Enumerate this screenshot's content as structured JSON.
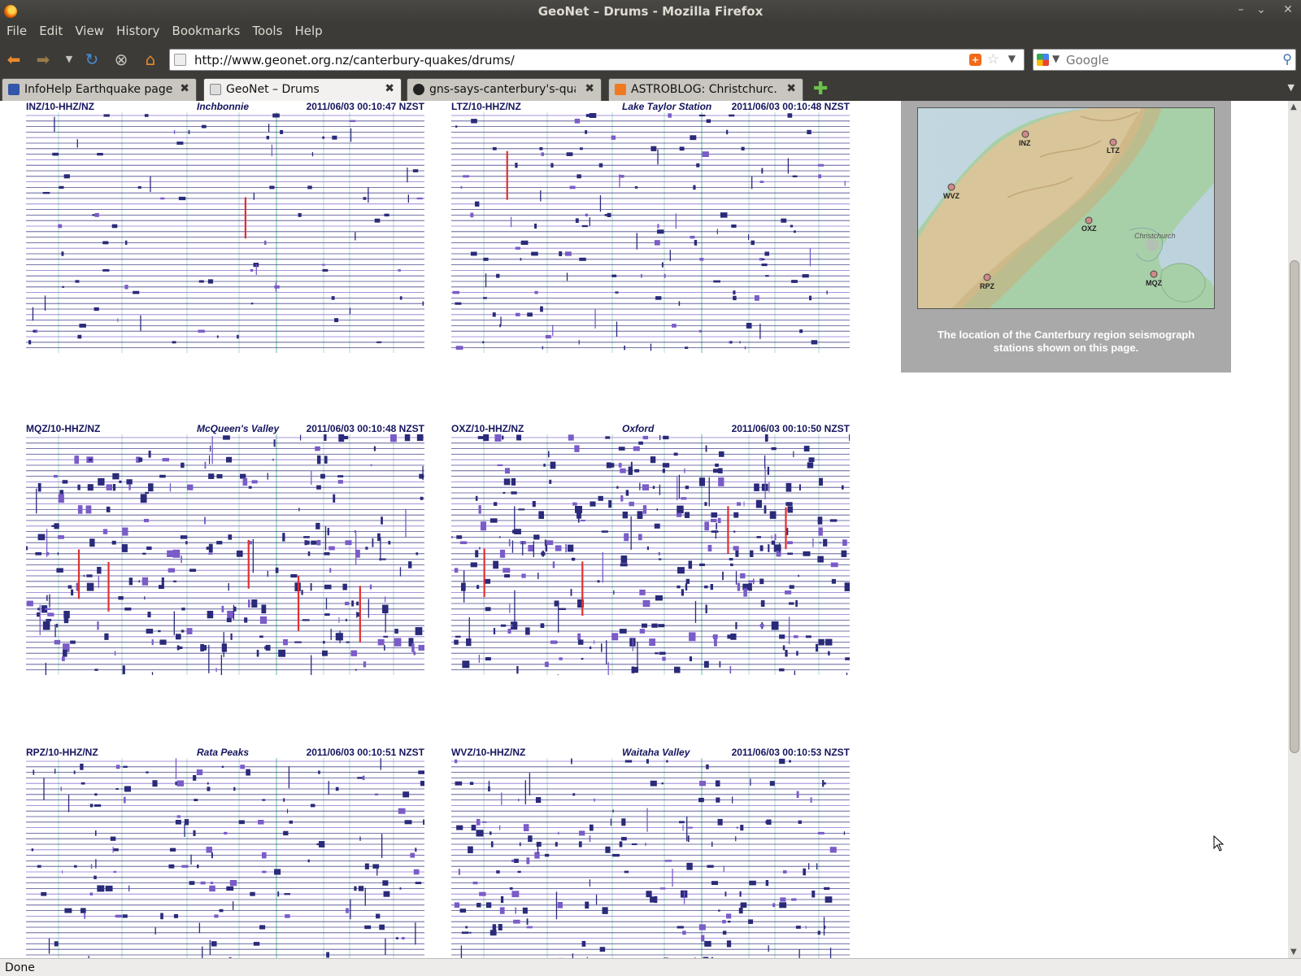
{
  "window": {
    "title": "GeoNet – Drums - Mozilla Firefox"
  },
  "menu": [
    "File",
    "Edit",
    "View",
    "History",
    "Bookmarks",
    "Tools",
    "Help"
  ],
  "nav": {
    "url": "http://www.geonet.org.nz/canterbury-quakes/drums/",
    "search_placeholder": "Google"
  },
  "tabs": [
    {
      "label": "InfoHelp Earthquake page",
      "active": false
    },
    {
      "label": "GeoNet – Drums",
      "active": true
    },
    {
      "label": "gns-says-canterbury's-qua...",
      "active": false
    },
    {
      "label": "ASTROBLOG: Christchurc...",
      "active": false
    }
  ],
  "drums": [
    {
      "code": "INZ/10-HHZ/NZ",
      "name": "Inchbonnie",
      "timestamp": "2011/06/03 00:10:47 NZST"
    },
    {
      "code": "LTZ/10-HHZ/NZ",
      "name": "Lake Taylor Station",
      "timestamp": "2011/06/03 00:10:48 NZST"
    },
    {
      "code": "MQZ/10-HHZ/NZ",
      "name": "McQueen's Valley",
      "timestamp": "2011/06/03 00:10:48 NZST"
    },
    {
      "code": "OXZ/10-HHZ/NZ",
      "name": "Oxford",
      "timestamp": "2011/06/03 00:10:50 NZST"
    },
    {
      "code": "RPZ/10-HHZ/NZ",
      "name": "Rata Peaks",
      "timestamp": "2011/06/03 00:10:51 NZST"
    },
    {
      "code": "WVZ/10-HHZ/NZ",
      "name": "Waitaha Valley",
      "timestamp": "2011/06/03 00:10:53 NZST"
    }
  ],
  "map": {
    "stations": [
      "INZ",
      "LTZ",
      "WVZ",
      "OXZ",
      "RPZ",
      "MQZ"
    ],
    "city": "Christchurch",
    "caption": "The location of the Canterbury region seismograph stations shown on this page."
  },
  "status": "Done",
  "colors": {
    "trace_blue": "#2a2a7a",
    "trace_violet": "#7a5cc8",
    "event_red": "#e03030",
    "grid_green": "#7fc8a8"
  }
}
